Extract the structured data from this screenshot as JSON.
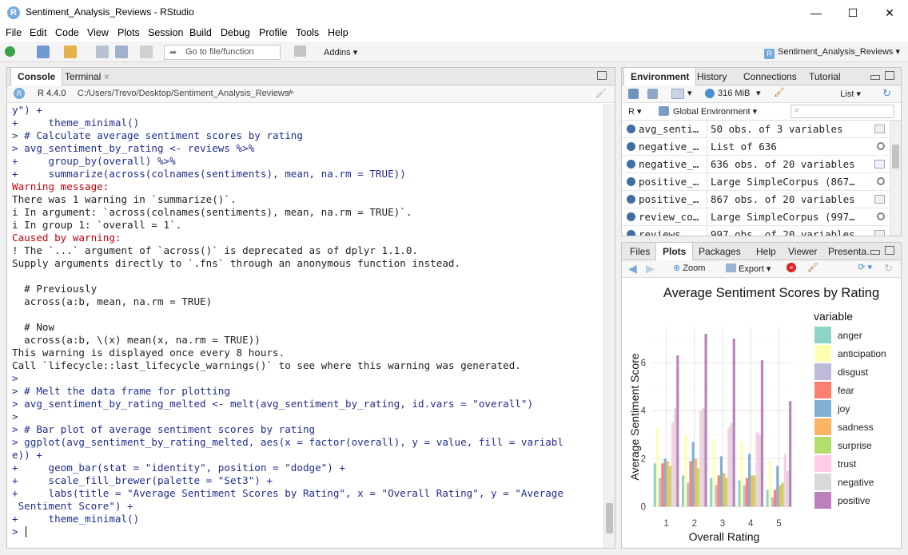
{
  "window": {
    "title": "Sentiment_Analysis_Reviews - RStudio",
    "logo": "R",
    "min": "—",
    "max": "☐",
    "close": "✕"
  },
  "menu": [
    "File",
    "Edit",
    "Code",
    "View",
    "Plots",
    "Session",
    "Build",
    "Debug",
    "Profile",
    "Tools",
    "Help"
  ],
  "toolbar": {
    "goto_placeholder": "Go to file/function",
    "addins": "Addins",
    "project": "Sentiment_Analysis_Reviews"
  },
  "console": {
    "tabs": [
      "Console",
      "Terminal"
    ],
    "r_version": "R 4.4.0",
    "path": "C:/Users/Trevo/Desktop/Sentiment_Analysis_Reviews/",
    "lines": [
      {
        "t": "in",
        "s": "y\") +"
      },
      {
        "t": "in",
        "s": "+     theme_minimal()"
      },
      {
        "t": "in",
        "s": "> # Calculate average sentiment scores by rating"
      },
      {
        "t": "in",
        "s": "> avg_sentiment_by_rating <- reviews %>%"
      },
      {
        "t": "in",
        "s": "+     group_by(overall) %>%"
      },
      {
        "t": "in",
        "s": "+     summarize(across(colnames(sentiments), mean, na.rm = TRUE))"
      },
      {
        "t": "warn",
        "s": "Warning message:"
      },
      {
        "t": "out",
        "s": "There was 1 warning in `summarize()`."
      },
      {
        "t": "out",
        "s": "i In argument: `across(colnames(sentiments), mean, na.rm = TRUE)`."
      },
      {
        "t": "out",
        "s": "i In group 1: `overall = 1`."
      },
      {
        "t": "warn",
        "s": "Caused by warning:"
      },
      {
        "t": "out",
        "s": "! The `...` argument of `across()` is deprecated as of dplyr 1.1.0."
      },
      {
        "t": "out",
        "s": "Supply arguments directly to `.fns` through an anonymous function instead."
      },
      {
        "t": "out",
        "s": ""
      },
      {
        "t": "out",
        "s": "  # Previously"
      },
      {
        "t": "out",
        "s": "  across(a:b, mean, na.rm = TRUE)"
      },
      {
        "t": "out",
        "s": ""
      },
      {
        "t": "out",
        "s": "  # Now"
      },
      {
        "t": "out",
        "s": "  across(a:b, \\(x) mean(x, na.rm = TRUE))"
      },
      {
        "t": "out",
        "s": "This warning is displayed once every 8 hours."
      },
      {
        "t": "out",
        "s": "Call `lifecycle::last_lifecycle_warnings()` to see where this warning was generated."
      },
      {
        "t": "in",
        "s": ">"
      },
      {
        "t": "in",
        "s": "> # Melt the data frame for plotting"
      },
      {
        "t": "in",
        "s": "> avg_sentiment_by_rating_melted <- melt(avg_sentiment_by_rating, id.vars = \"overall\")"
      },
      {
        "t": "in",
        "s": ">"
      },
      {
        "t": "in",
        "s": "> # Bar plot of average sentiment scores by rating"
      },
      {
        "t": "in",
        "s": "> ggplot(avg_sentiment_by_rating_melted, aes(x = factor(overall), y = value, fill = variabl"
      },
      {
        "t": "in",
        "s": "e)) +"
      },
      {
        "t": "in",
        "s": "+     geom_bar(stat = \"identity\", position = \"dodge\") +"
      },
      {
        "t": "in",
        "s": "+     scale_fill_brewer(palette = \"Set3\") +"
      },
      {
        "t": "in",
        "s": "+     labs(title = \"Average Sentiment Scores by Rating\", x = \"Overall Rating\", y = \"Average"
      },
      {
        "t": "in",
        "s": " Sentiment Score\") +"
      },
      {
        "t": "in",
        "s": "+     theme_minimal()"
      },
      {
        "t": "in",
        "s": "> "
      }
    ]
  },
  "environment": {
    "tabs": [
      "Environment",
      "History",
      "Connections",
      "Tutorial"
    ],
    "memory": "316 MiB",
    "list_label": "List",
    "lang": "R",
    "scope": "Global Environment",
    "rows": [
      {
        "name": "avg_senti…",
        "value": "50 obs. of 3 variables",
        "icon": "table-icon"
      },
      {
        "name": "negative_…",
        "value": "List of  636",
        "icon": "magnifier-icon"
      },
      {
        "name": "negative_…",
        "value": "636 obs. of 20 variables",
        "icon": "table-icon"
      },
      {
        "name": "positive_…",
        "value": "Large SimpleCorpus (867…",
        "icon": "magnifier-icon"
      },
      {
        "name": "positive_…",
        "value": "867 obs. of 20 variables",
        "icon": "table-icon"
      },
      {
        "name": "review_co…",
        "value": "Large SimpleCorpus (997…",
        "icon": "magnifier-icon"
      },
      {
        "name": "reviews",
        "value": "997 obs. of 20 variables",
        "icon": "table-icon"
      }
    ]
  },
  "files": {
    "tabs": [
      "Files",
      "Plots",
      "Packages",
      "Help",
      "Viewer",
      "Presenta…"
    ],
    "zoom": "Zoom",
    "export": "Export"
  },
  "chart_data": {
    "type": "bar",
    "title": "Average Sentiment Scores by Rating",
    "xlabel": "Overall Rating",
    "ylabel": "Average Sentiment Score",
    "ylim": [
      -0.15,
      7.5
    ],
    "yticks": [
      0,
      2,
      4,
      6
    ],
    "legend_title": "variable",
    "legend_position": "right",
    "grid": true,
    "categories": [
      "1",
      "2",
      "3",
      "4",
      "5"
    ],
    "series": [
      {
        "name": "anger",
        "color": "#8DD3C7",
        "values": [
          1.8,
          1.3,
          1.2,
          1.1,
          0.7
        ]
      },
      {
        "name": "anticipation",
        "color": "#FFFFB3",
        "values": [
          3.3,
          3.0,
          2.8,
          2.7,
          1.9
        ]
      },
      {
        "name": "disgust",
        "color": "#BEBADA",
        "values": [
          1.2,
          1.0,
          0.9,
          0.9,
          0.4
        ]
      },
      {
        "name": "fear",
        "color": "#FB8072",
        "values": [
          1.8,
          1.9,
          1.3,
          1.2,
          0.7
        ]
      },
      {
        "name": "joy",
        "color": "#80B1D3",
        "values": [
          2.0,
          2.7,
          2.1,
          2.2,
          1.7
        ]
      },
      {
        "name": "sadness",
        "color": "#FDB462",
        "values": [
          1.9,
          2.0,
          1.4,
          1.3,
          0.9
        ]
      },
      {
        "name": "surprise",
        "color": "#B3DE69",
        "values": [
          1.7,
          1.6,
          1.2,
          1.3,
          1.0
        ]
      },
      {
        "name": "trust",
        "color": "#FCCDE5",
        "values": [
          3.5,
          4.0,
          3.3,
          3.1,
          2.2
        ]
      },
      {
        "name": "negative",
        "color": "#D9D9D9",
        "values": [
          4.1,
          4.1,
          3.5,
          3.0,
          1.5
        ]
      },
      {
        "name": "positive",
        "color": "#BC80BD",
        "values": [
          6.3,
          7.2,
          7.0,
          6.1,
          4.4
        ]
      }
    ]
  }
}
